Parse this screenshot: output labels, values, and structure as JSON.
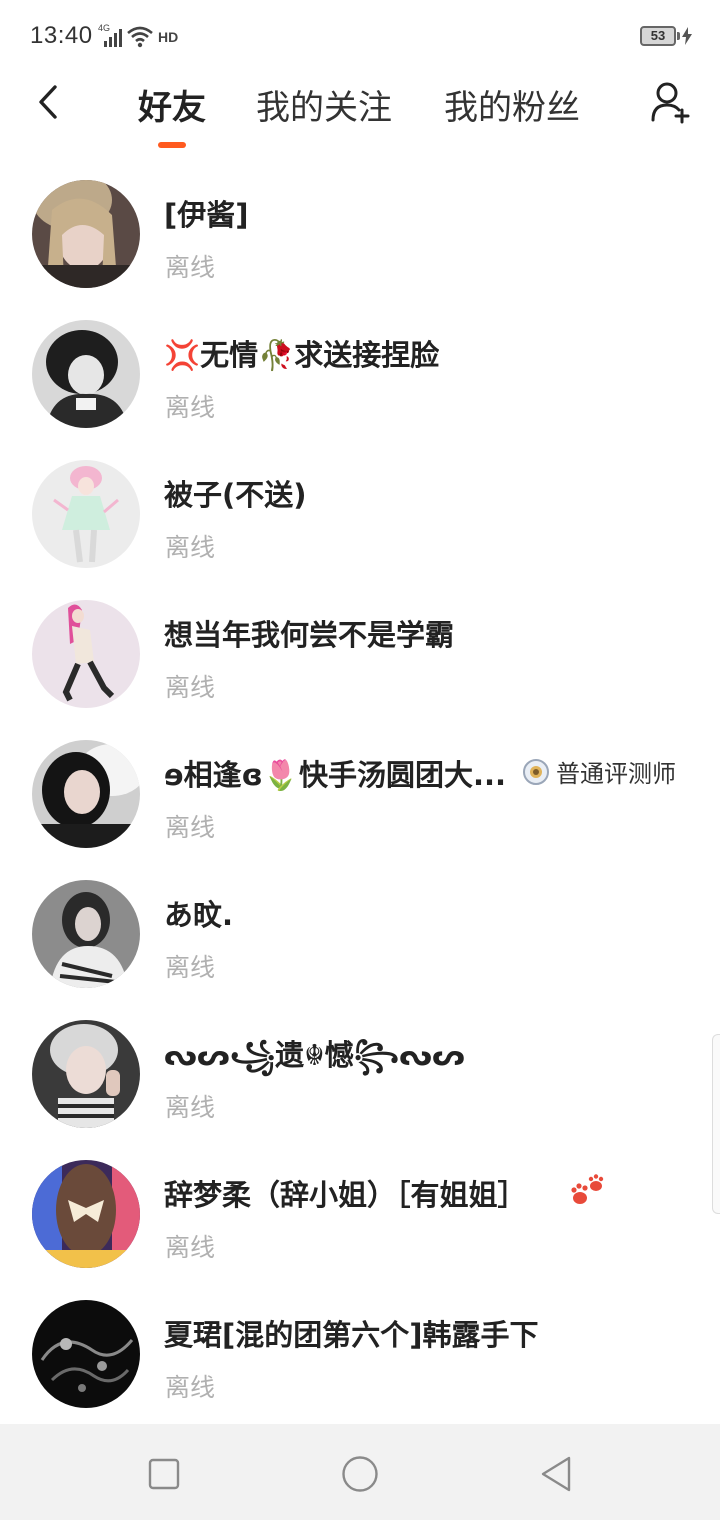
{
  "status_bar": {
    "time": "13:40",
    "network_label": "4G",
    "hd_label": "HD",
    "battery_level": "53"
  },
  "header": {
    "tabs": [
      {
        "label": "好友",
        "active": true
      },
      {
        "label": "我的关注",
        "active": false
      },
      {
        "label": "我的粉丝",
        "active": false
      }
    ],
    "accent_color": "#ff5a1f"
  },
  "friends": [
    {
      "name": "[伊酱]",
      "status": "离线"
    },
    {
      "name": "💢无情🥀求送接捏脸",
      "status": "离线"
    },
    {
      "name": "被子(不送)",
      "status": "离线"
    },
    {
      "name": "想当年我何尝不是学霸",
      "status": "离线"
    },
    {
      "name": "ɘ相逢ɞ🌷快手汤圆团大...",
      "status": "离线",
      "badge": {
        "label": "普通评测师",
        "icon": "reviewer-badge-icon"
      }
    },
    {
      "name": "あ旼.",
      "status": "离线"
    },
    {
      "name": "ᔓᔕ꧁遗☬憾꧂ᔓᔕ",
      "status": "离线"
    },
    {
      "name": "辞梦柔（辞小姐）［有姐姐］",
      "status": "离线",
      "trailing_icon": "paw-icon"
    },
    {
      "name": "夏珺[混的团第六个]韩露手下",
      "status": "离线"
    }
  ]
}
